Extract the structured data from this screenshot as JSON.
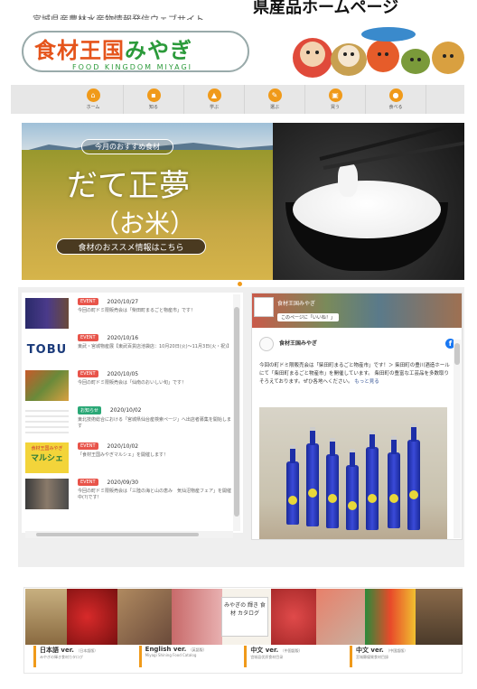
{
  "header": {
    "subtitle": "宮城県産農林水産物情報発信ウェブサイト",
    "site_title_top": "県産品ホームページ"
  },
  "logo": {
    "name_main": "食材王国",
    "name_kana": "みやぎ",
    "name_en": "FOOD KINGDOM MIYAGI"
  },
  "nav": {
    "items": [
      {
        "label": "ホーム",
        "icon": "home-icon"
      },
      {
        "label": "知る",
        "icon": "book-icon"
      },
      {
        "label": "学ぶ",
        "icon": "cap-icon"
      },
      {
        "label": "選ぶ",
        "icon": "leaf-icon"
      },
      {
        "label": "買う",
        "icon": "cart-icon"
      },
      {
        "label": "食べる",
        "icon": "bowl-icon"
      }
    ],
    "accent": "#f09a1a"
  },
  "hero": {
    "tag": "今月のおすすめ食材",
    "title_line1": "だて正夢",
    "title_line2": "（お米）",
    "cta": "食材のおススメ情報はこちら"
  },
  "news": {
    "items": [
      {
        "badge": "EVENT",
        "badge_color": "#e8544a",
        "date": "2020/10/27",
        "title": "今回の町ドミ限販売会は「柴田町まるごと物産市」です！"
      },
      {
        "badge": "EVENT",
        "badge_color": "#e8544a",
        "date": "2020/10/16",
        "title": "東武・宮城物産展【東武百貨店池袋店：10月20日(火)～11月3日(火・祝)】"
      },
      {
        "badge": "EVENT",
        "badge_color": "#e8544a",
        "date": "2020/10/05",
        "title": "今回の町ドミ限販売会は「仙南のおいしい旬」です！"
      },
      {
        "badge": "お知らせ",
        "badge_color": "#2aa876",
        "date": "2020/10/02",
        "title": "東北技術総合における「宮城県仙台産検索ページ」へ出店者募集を開始します"
      },
      {
        "badge": "EVENT",
        "badge_color": "#e8544a",
        "date": "2020/10/02",
        "title": "「食材王国みやぎマルシェ」を開催します！"
      },
      {
        "badge": "EVENT",
        "badge_color": "#e8544a",
        "date": "2020/09/30",
        "title": "今回の町ドミ限販売会は「三陸の海と山の恵み　気仙沼物産フェア」を開催中(?)です！"
      }
    ],
    "thumb_tobu": "TOBU",
    "thumb_marche_line1": "食材王国みやぎ",
    "thumb_marche_line2": "マルシェ"
  },
  "facebook": {
    "page_name": "食材王国みやぎ",
    "like_label": "このページに「いいね！」",
    "post_author": "食材王国みやぎ",
    "post_date": "",
    "post_text": "今回の町ドミ限販売会は「柴田町まるごと物産市」です！＞ 柴田町の豊川酒造ホールにて「柴田町まるごと物産市」を開催しています。 柴田町の豊富な工芸品を多数取りそろえております。ぜひ各地へください。",
    "more_label": "もっと見る",
    "fb_logo": "f"
  },
  "banner": {
    "catalog_text": "みやぎの 輝き 食材 カタログ",
    "langs": [
      {
        "title": "日本語 ver.",
        "tag": "（日本語版）",
        "desc": "みやぎの輝き食材カタログ"
      },
      {
        "title": "English ver.",
        "tag": "（英語版）",
        "desc": "Miyagi Shining Food Catalog"
      },
      {
        "title": "中文 ver.",
        "tag": "（中国語版）",
        "desc": "宫城县优质食材目录"
      },
      {
        "title": "中文 ver.",
        "tag": "（中国語版）",
        "desc": "宮城縣優質食材目錄"
      }
    ]
  }
}
